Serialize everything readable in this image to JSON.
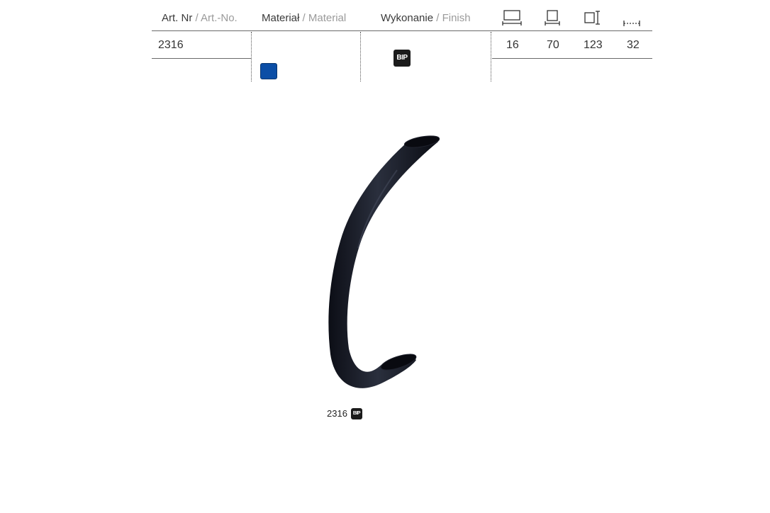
{
  "table": {
    "headers": {
      "artnr_pl": "Art. Nr",
      "artnr_sep": " / ",
      "artnr_en": "Art.-No.",
      "material_pl": "Materiał",
      "material_sep": " / ",
      "material_en": "Material",
      "finish_pl": "Wykonanie",
      "finish_sep": " / ",
      "finish_en": "Finish"
    },
    "dimension_icons": [
      "width-icon",
      "depth-icon",
      "height-icon",
      "spacing-icon"
    ],
    "row": {
      "art_no": "2316",
      "material_color": "#0b4ea6",
      "finish_code": "BIP",
      "dim_1": "16",
      "dim_2": "70",
      "dim_3": "123",
      "dim_4": "32"
    }
  },
  "product": {
    "caption_no": "2316",
    "caption_finish": "BIP",
    "color": "#14161f"
  }
}
